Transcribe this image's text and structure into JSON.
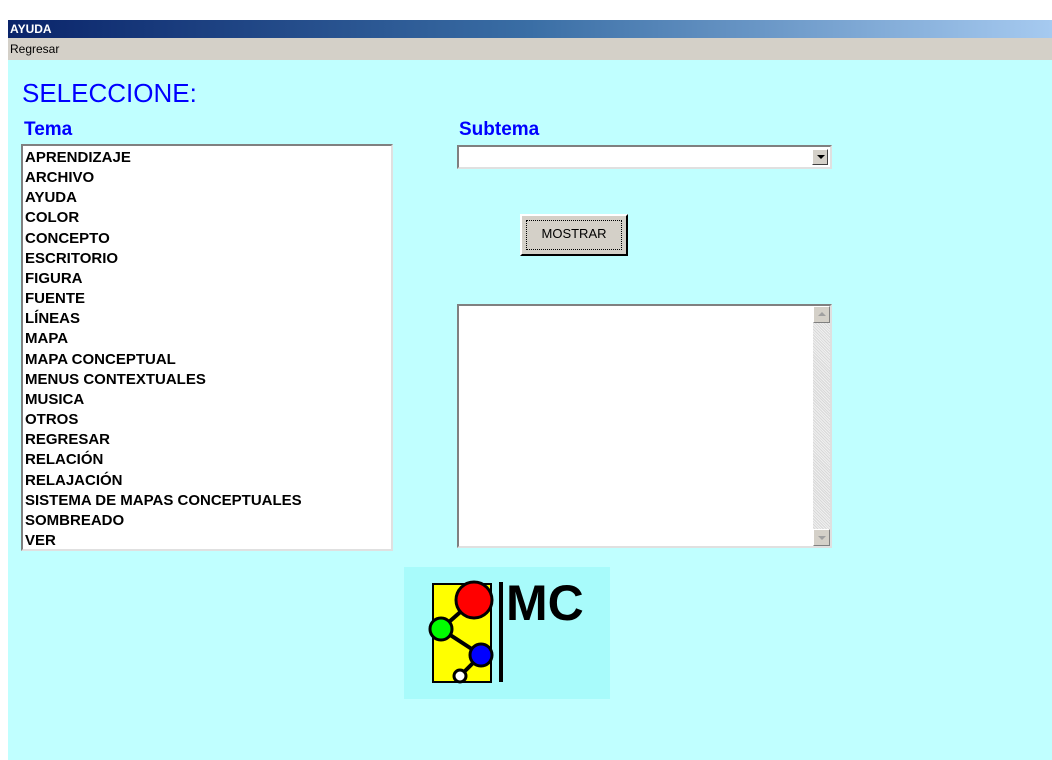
{
  "window": {
    "title": "AYUDA"
  },
  "menu": {
    "items": [
      {
        "label": "Regresar"
      }
    ]
  },
  "heading": "SELECCIONE:",
  "tema": {
    "label": "Tema",
    "items": [
      "APRENDIZAJE",
      "ARCHIVO",
      "AYUDA",
      "COLOR",
      "CONCEPTO",
      "ESCRITORIO",
      "FIGURA",
      "FUENTE",
      "LÍNEAS",
      "MAPA",
      "MAPA CONCEPTUAL",
      "MENUS CONTEXTUALES",
      "MUSICA",
      "OTROS",
      "REGRESAR",
      "RELACIÓN",
      "RELAJACIÓN",
      "SISTEMA DE MAPAS CONCEPTUALES",
      "SOMBREADO",
      "VER"
    ]
  },
  "subtema": {
    "label": "Subtema",
    "selected": ""
  },
  "actions": {
    "show_label": "MOSTRAR"
  },
  "output": {
    "text": ""
  },
  "logo": {
    "text": "MC",
    "icon": "concept-map-logo"
  },
  "colors": {
    "background": "#c0ffff",
    "title_bar": "#0a246a",
    "heading": "#0000ff",
    "logo_yellow": "#ffff00",
    "logo_red": "#ff0000",
    "logo_green": "#00ff00",
    "logo_blue": "#0000ff"
  }
}
